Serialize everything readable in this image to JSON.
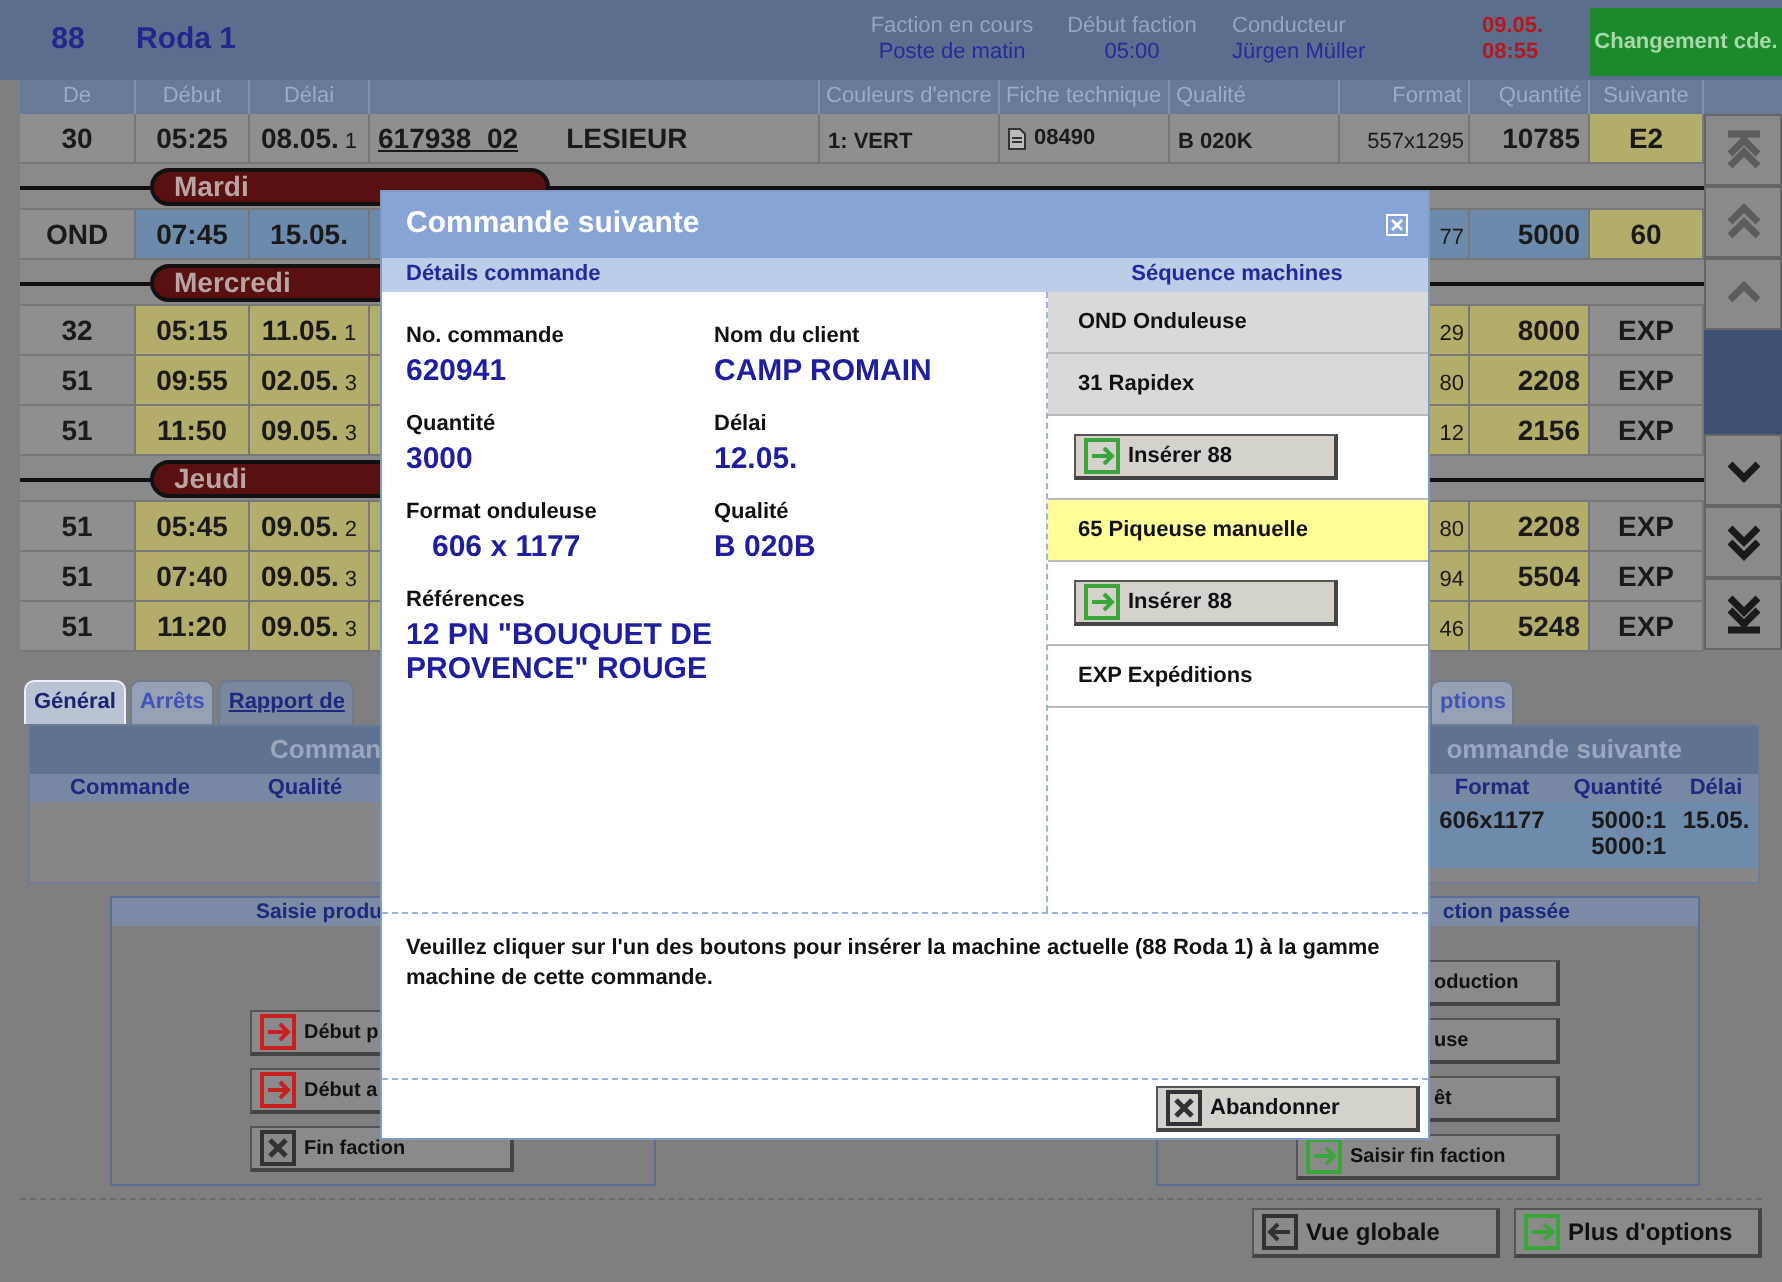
{
  "header": {
    "machine_number": "88",
    "machine_name": "Roda 1",
    "info": [
      {
        "label": "Faction en cours",
        "value": "Poste de matin"
      },
      {
        "label": "Début faction",
        "value": "05:00"
      },
      {
        "label": "Conducteur",
        "value": "Jürgen Müller"
      }
    ],
    "clock": {
      "date": "09.05.",
      "time": "08:55"
    },
    "change_button": "Changement cde."
  },
  "table": {
    "columns": [
      "De",
      "Début",
      "Délai",
      "Couleurs d'encre",
      "Fiche technique",
      "Qualité",
      "Format",
      "Quantité",
      "Suivante"
    ],
    "rows": [
      {
        "kind": "current",
        "de": "30",
        "debut": "05:25",
        "delai": "08.05.",
        "priority": "1",
        "reference": "617938  02",
        "client": "LESIEUR",
        "inks": "1: VERT",
        "technical_sheet": "08490",
        "quality": "B 020K",
        "format": "557x1295",
        "quantity": "10785",
        "next": "E2"
      },
      {
        "kind": "day",
        "label": "Mardi"
      },
      {
        "kind": "next",
        "de": "OND",
        "debut": "07:45",
        "delai": "15.05.",
        "format": "77",
        "quantity": "5000",
        "next": "60"
      },
      {
        "kind": "day",
        "label": "Mercredi"
      },
      {
        "kind": "planned",
        "de": "32",
        "debut": "05:15",
        "delai": "11.05.",
        "priority": "1",
        "format": "29",
        "quantity": "8000",
        "next": "EXP"
      },
      {
        "kind": "planned",
        "de": "51",
        "debut": "09:55",
        "delai": "02.05.",
        "priority": "3",
        "format": "80",
        "quantity": "2208",
        "next": "EXP"
      },
      {
        "kind": "planned",
        "de": "51",
        "debut": "11:50",
        "delai": "09.05.",
        "priority": "3",
        "format": "12",
        "quantity": "2156",
        "next": "EXP"
      },
      {
        "kind": "day",
        "label": "Jeudi"
      },
      {
        "kind": "planned",
        "de": "51",
        "debut": "05:45",
        "delai": "09.05.",
        "priority": "2",
        "format": "80",
        "quantity": "2208",
        "next": "EXP"
      },
      {
        "kind": "planned",
        "de": "51",
        "debut": "07:40",
        "delai": "09.05.",
        "priority": "3",
        "format": "94",
        "quantity": "5504",
        "next": "EXP"
      },
      {
        "kind": "planned",
        "de": "51",
        "debut": "11:20",
        "delai": "09.05.",
        "priority": "3",
        "format": "46",
        "quantity": "5248",
        "next": "EXP"
      }
    ]
  },
  "tabs": [
    {
      "label": "Général",
      "selected": true,
      "disabled": false
    },
    {
      "label": "Arrêts",
      "selected": false,
      "disabled": true
    },
    {
      "label": "Rapport de",
      "selected": false,
      "disabled": false
    },
    {
      "label": "ptions",
      "selected": false,
      "disabled": true
    }
  ],
  "current_order": {
    "title": "Comman",
    "columns": [
      "Commande",
      "Qualité"
    ]
  },
  "next_order": {
    "title": "ommande suivante",
    "columns": [
      "Format",
      "Quantité",
      "Délai"
    ],
    "values": [
      "606x1177",
      "5000:1\n5000:1",
      "15.05."
    ]
  },
  "production_panel": {
    "title": "Saisie produ",
    "buttons": [
      {
        "kind": "start",
        "label": "Début p"
      },
      {
        "kind": "start",
        "label": "Début a"
      },
      {
        "kind": "end",
        "label": "Fin faction"
      }
    ]
  },
  "past_panel": {
    "title": "ction passée",
    "buttons": [
      {
        "kind": "cut",
        "label": "oduction"
      },
      {
        "kind": "cut",
        "label": "use"
      },
      {
        "kind": "cut",
        "label": "êt"
      },
      {
        "kind": "enter",
        "label": "Saisir fin faction"
      }
    ]
  },
  "footer_buttons": [
    {
      "kind": "back",
      "label": "Vue globale"
    },
    {
      "kind": "enter",
      "label": "Plus d'options"
    }
  ],
  "modal": {
    "title": "Commande suivante",
    "details_heading": "Détails commande",
    "sequence_heading": "Séquence machines",
    "fields": [
      {
        "kind": "field",
        "label": "No. commande",
        "value": "620941"
      },
      {
        "kind": "field",
        "label": "Nom du client",
        "value": "CAMP ROMAIN"
      },
      {
        "kind": "field",
        "label": "Quantité",
        "value": "3000"
      },
      {
        "kind": "field",
        "label": "Délai",
        "value": "12.05."
      },
      {
        "kind": "indented",
        "label": "Format onduleuse",
        "value": "606 x 1177"
      },
      {
        "kind": "field",
        "label": "Qualité",
        "value": "B 020B"
      },
      {
        "kind": "wide",
        "label": "Références",
        "value": "12 PN \"BOUQUET DE PROVENCE\" ROUGE"
      }
    ],
    "sequence": [
      {
        "kind": "machine",
        "label": "OND Onduleuse",
        "color": "#d9d9d9"
      },
      {
        "kind": "machine",
        "label": "31 Rapidex",
        "color": "#d9d9d9"
      },
      {
        "kind": "insert",
        "label": "Insérer 88"
      },
      {
        "kind": "machine",
        "label": "65 Piqueuse manuelle",
        "color": "#ffff99"
      },
      {
        "kind": "insert",
        "label": "Insérer 88"
      },
      {
        "kind": "machine",
        "label": "EXP Expéditions",
        "color": "#ffffff"
      }
    ],
    "message": "Veuillez cliquer sur l'un des boutons pour insérer la machine actuelle (88 Roda **1**) à la gamme machine de cette commande.",
    "cancel_button": "Abandonner"
  }
}
